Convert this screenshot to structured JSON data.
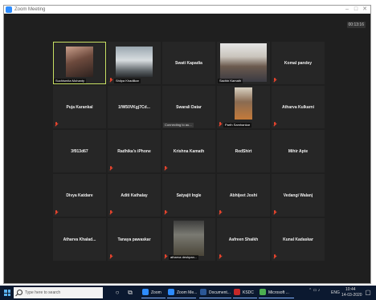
{
  "window": {
    "title": "Zoom Meeting",
    "controls": [
      "–",
      "□",
      "✕"
    ],
    "timer": "00:13:16"
  },
  "participants": [
    {
      "name": "",
      "label": "Suchismita Mohanty",
      "video": "selfie",
      "active": true,
      "muted": false
    },
    {
      "name": "",
      "label": "Shilpa Khadilkar",
      "video": "car",
      "active": false,
      "muted": true
    },
    {
      "name": "Swati Kapadia",
      "label": "",
      "muted": false
    },
    {
      "name": "",
      "label": "Sachin Kamath",
      "video": "man",
      "muted": false
    },
    {
      "name": "Komal pandey",
      "label": "",
      "muted": true
    },
    {
      "name": "Puja Karankal",
      "label": "",
      "muted": true
    },
    {
      "name": "1fW50VKgj7Cd...",
      "label": "",
      "muted": false
    },
    {
      "name": "Swarali Datar",
      "label": "",
      "status": "Connecting to au...",
      "muted": false
    },
    {
      "name": "",
      "label": "Parth Samhankar",
      "video": "portrait",
      "muted": true
    },
    {
      "name": "Atharva Kulkarni",
      "label": "",
      "muted": true
    },
    {
      "name": "3f913d67",
      "label": "",
      "muted": false
    },
    {
      "name": "Radhika's iPhone",
      "label": "",
      "muted": true
    },
    {
      "name": "Krishna Kamath",
      "label": "",
      "muted": true
    },
    {
      "name": "RedShirt",
      "label": "",
      "muted": false
    },
    {
      "name": "Mihir Apte",
      "label": "",
      "muted": false
    },
    {
      "name": "Divya Katdare",
      "label": "",
      "muted": true
    },
    {
      "name": "Aditi Kathalay",
      "label": "",
      "muted": true
    },
    {
      "name": "Satyajit Ingle",
      "label": "",
      "muted": true
    },
    {
      "name": "Abhijeet Joshi",
      "label": "",
      "muted": true
    },
    {
      "name": "Vedangi Walanj",
      "label": "",
      "muted": true
    },
    {
      "name": "Atharva Khalad...",
      "label": "",
      "muted": false
    },
    {
      "name": "Tanaya pawaskar",
      "label": "",
      "muted": true
    },
    {
      "name": "",
      "label": "atharva deshpan...",
      "video": "room",
      "muted": true
    },
    {
      "name": "Aafreen Shaikh",
      "label": "",
      "muted": true
    },
    {
      "name": "Kunal Kadaskar",
      "label": "",
      "muted": true
    }
  ],
  "taskbar": {
    "search_placeholder": "Type here to search",
    "apps": [
      {
        "label": "Zoom",
        "color": "#2d8cff"
      },
      {
        "label": "Zoom Me...",
        "color": "#2d8cff"
      },
      {
        "label": "Document...",
        "color": "#2b5797"
      },
      {
        "label": "KSDC",
        "color": "#c62828"
      },
      {
        "label": "Microsoft ...",
        "color": "#4caf50"
      }
    ],
    "lang": "ENG",
    "time": "10:44",
    "date": "14-03-2020"
  }
}
